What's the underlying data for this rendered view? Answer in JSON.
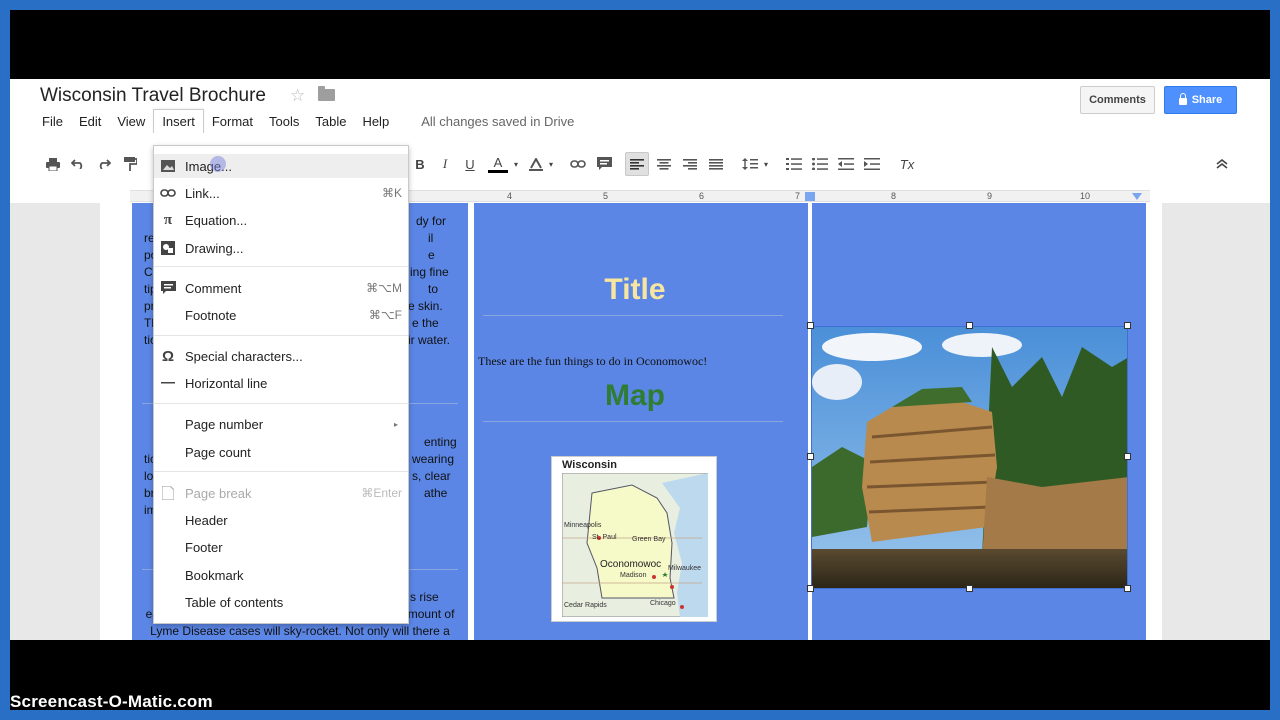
{
  "doc": {
    "title": "Wisconsin Travel Brochure",
    "save_status": "All changes saved in Drive"
  },
  "header": {
    "comments_label": "Comments",
    "share_label": "Share"
  },
  "menubar": {
    "items": [
      "File",
      "Edit",
      "View",
      "Insert",
      "Format",
      "Tools",
      "Table",
      "Help"
    ]
  },
  "toolbar": {
    "bold": "B",
    "italic": "I",
    "underline": "U",
    "text_color": "A",
    "clear_format": "Tx"
  },
  "ruler": {
    "labels": [
      "4",
      "5",
      "6",
      "7",
      "8",
      "9",
      "10"
    ]
  },
  "insert_menu": {
    "items": [
      {
        "label": "Image...",
        "shortcut": "",
        "icon": "image-icon"
      },
      {
        "label": "Link...",
        "shortcut": "⌘K",
        "icon": "link-icon"
      },
      {
        "label": "Equation...",
        "shortcut": "",
        "icon": "pi-icon"
      },
      {
        "label": "Drawing...",
        "shortcut": "",
        "icon": "drawing-icon"
      },
      {
        "label": "Comment",
        "shortcut": "⌘⌥M",
        "icon": "comment-icon"
      },
      {
        "label": "Footnote",
        "shortcut": "⌘⌥F",
        "icon": ""
      },
      {
        "label": "Special characters...",
        "shortcut": "",
        "icon": "omega-icon"
      },
      {
        "label": "Horizontal line",
        "shortcut": "",
        "icon": "horizontal-line-icon"
      },
      {
        "label": "Page number",
        "shortcut": "",
        "icon": ""
      },
      {
        "label": "Page count",
        "shortcut": "",
        "icon": ""
      },
      {
        "label": "Page break",
        "shortcut": "⌘Enter",
        "icon": "page-break-icon"
      },
      {
        "label": "Header",
        "shortcut": "",
        "icon": ""
      },
      {
        "label": "Footer",
        "shortcut": "",
        "icon": ""
      },
      {
        "label": "Bookmark",
        "shortcut": "",
        "icon": ""
      },
      {
        "label": "Table of contents",
        "shortcut": "",
        "icon": ""
      }
    ]
  },
  "left_column": {
    "para1": [
      "It",
      "rem",
      "poli",
      "Cor",
      "tipp",
      "prev",
      "The",
      "tick"
    ],
    "para1_right": [
      "dy for",
      "il",
      "e",
      "ing fine",
      "to",
      "e skin.",
      "e the",
      "ir water."
    ],
    "para2": [
      "T",
      "tick",
      "long",
      "brus",
      "imm"
    ],
    "para2_right": [
      "enting",
      "wearing",
      "s, clear",
      "athe"
    ],
    "para3_right": "s rise",
    "para3": [
      "earlier and earlier each year. It is suspected the amount of",
      "Lyme Disease cases will sky-rocket. Not only will there a"
    ]
  },
  "middle_column": {
    "title": "Title",
    "fun_text": "These are the fun things to do in Oconomowoc!",
    "map_heading": "Map",
    "map_label": "Wisconsin",
    "map_cities": [
      "Minneapolis",
      "St. Paul",
      "Green Bay",
      "Oconomowoc",
      "Madison",
      "Milwaukee",
      "Cedar Rapids",
      "Chicago"
    ]
  },
  "watermark": "Screencast-O-Matic.com"
}
